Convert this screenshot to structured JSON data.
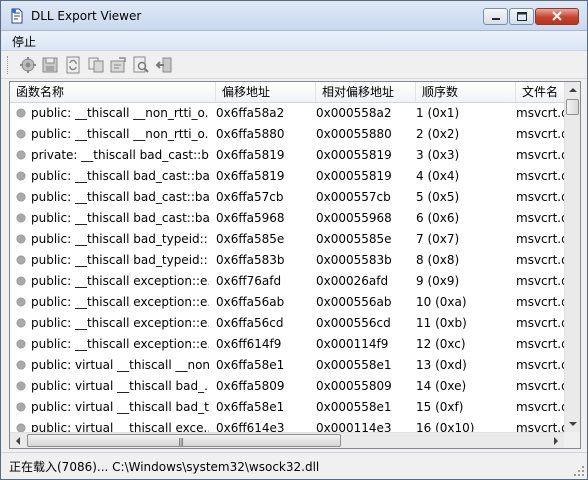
{
  "window": {
    "title": "DLL Export Viewer"
  },
  "menu": {
    "items": [
      {
        "label": "停止"
      }
    ]
  },
  "toolbar": {
    "buttons": [
      {
        "icon": "stop-icon"
      },
      {
        "icon": "save-icon"
      },
      {
        "icon": "refresh-icon"
      },
      {
        "icon": "copy-icon"
      },
      {
        "icon": "properties-icon"
      },
      {
        "icon": "find-icon"
      },
      {
        "icon": "exit-icon"
      }
    ]
  },
  "table": {
    "columns": [
      "函数名称",
      "偏移地址",
      "相对偏移地址",
      "顺序数",
      "文件名"
    ],
    "rows": [
      [
        "public: __thiscall __non_rtti_o...",
        "0x6ffa58a2",
        "0x000558a2",
        "1 (0x1)",
        "msvcrt.d"
      ],
      [
        "public: __thiscall __non_rtti_o...",
        "0x6ffa5880",
        "0x00055880",
        "2 (0x2)",
        "msvcrt.d"
      ],
      [
        "private: __thiscall bad_cast::b...",
        "0x6ffa5819",
        "0x00055819",
        "3 (0x3)",
        "msvcrt.d"
      ],
      [
        "public: __thiscall bad_cast::ba...",
        "0x6ffa5819",
        "0x00055819",
        "4 (0x4)",
        "msvcrt.d"
      ],
      [
        "public: __thiscall bad_cast::ba...",
        "0x6ffa57cb",
        "0x000557cb",
        "5 (0x5)",
        "msvcrt.d"
      ],
      [
        "public: __thiscall bad_cast::ba...",
        "0x6ffa5968",
        "0x00055968",
        "6 (0x6)",
        "msvcrt.d"
      ],
      [
        "public: __thiscall bad_typeid::...",
        "0x6ffa585e",
        "0x0005585e",
        "7 (0x7)",
        "msvcrt.d"
      ],
      [
        "public: __thiscall bad_typeid::...",
        "0x6ffa583b",
        "0x0005583b",
        "8 (0x8)",
        "msvcrt.d"
      ],
      [
        "public: __thiscall exception::e...",
        "0x6ff76afd",
        "0x00026afd",
        "9 (0x9)",
        "msvcrt.d"
      ],
      [
        "public: __thiscall exception::e...",
        "0x6ffa56ab",
        "0x000556ab",
        "10 (0xa)",
        "msvcrt.d"
      ],
      [
        "public: __thiscall exception::e...",
        "0x6ffa56cd",
        "0x000556cd",
        "11 (0xb)",
        "msvcrt.d"
      ],
      [
        "public: __thiscall exception::e...",
        "0x6ff614f9",
        "0x000114f9",
        "12 (0xc)",
        "msvcrt.d"
      ],
      [
        "public: virtual __thiscall __non...",
        "0x6ffa58e1",
        "0x000558e1",
        "13 (0xd)",
        "msvcrt.d"
      ],
      [
        "public: virtual __thiscall bad_...",
        "0x6ffa5809",
        "0x00055809",
        "14 (0xe)",
        "msvcrt.d"
      ],
      [
        "public: virtual __thiscall bad_t...",
        "0x6ffa58e1",
        "0x000558e1",
        "15 (0xf)",
        "msvcrt.d"
      ],
      [
        "public: virtual __thiscall exce...",
        "0x6ff614e3",
        "0x000114e3",
        "16 (0x10)",
        "msvcrt.d"
      ]
    ]
  },
  "status": {
    "text": "正在载入(7086)... C:\\Windows\\system32\\wsock32.dll"
  },
  "colors": {
    "title_bar": "#c9d9ee",
    "close_button": "#c7432d",
    "list_background": "#ffffff",
    "row_dot": "#a9a9a9"
  }
}
